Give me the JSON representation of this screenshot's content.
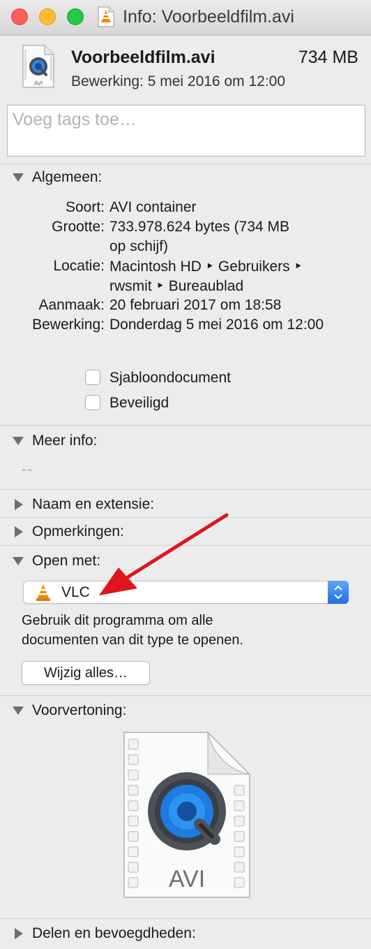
{
  "window": {
    "title": "Info: Voorbeeldfilm.avi"
  },
  "header": {
    "filename": "Voorbeeldfilm.avi",
    "size": "734 MB",
    "modified": "Bewerking: 5 mei 2016 om 12:00",
    "icon_badge": "AVI"
  },
  "tags": {
    "placeholder": "Voeg tags toe…"
  },
  "general": {
    "title": "Algemeen:",
    "rows": [
      {
        "label": "Soort:",
        "value": "AVI container"
      },
      {
        "label": "Grootte:",
        "value": "733.978.624 bytes (734 MB",
        "value2": "op schijf)"
      },
      {
        "label": "Locatie:",
        "value": "Macintosh HD ‣ Gebruikers ‣",
        "value2": "rwsmit ‣ Bureaublad"
      },
      {
        "label": "Aanmaak:",
        "value": "20 februari 2017 om 18:58"
      },
      {
        "label": "Bewerking:",
        "value": "Donderdag 5 mei 2016 om 12:00"
      }
    ],
    "checkboxes": [
      {
        "label": "Sjabloondocument",
        "checked": false
      },
      {
        "label": "Beveiligd",
        "checked": false
      }
    ]
  },
  "more_info": {
    "title": "Meer info:",
    "value": "--"
  },
  "name_ext": {
    "title": "Naam en extensie:"
  },
  "comments": {
    "title": "Opmerkingen:"
  },
  "open_with": {
    "title": "Open met:",
    "app": "VLC",
    "description_line1": "Gebruik dit programma om alle",
    "description_line2": "documenten van dit type te openen.",
    "change_all": "Wijzig alles…"
  },
  "preview": {
    "title": "Voorvertoning:",
    "badge": "AVI"
  },
  "sharing": {
    "title": "Delen en bevoegdheden:"
  },
  "colors": {
    "annotation_arrow": "#e0141d",
    "stepper_accent": "#2f7cf0",
    "vlc_orange": "#f08a13"
  }
}
